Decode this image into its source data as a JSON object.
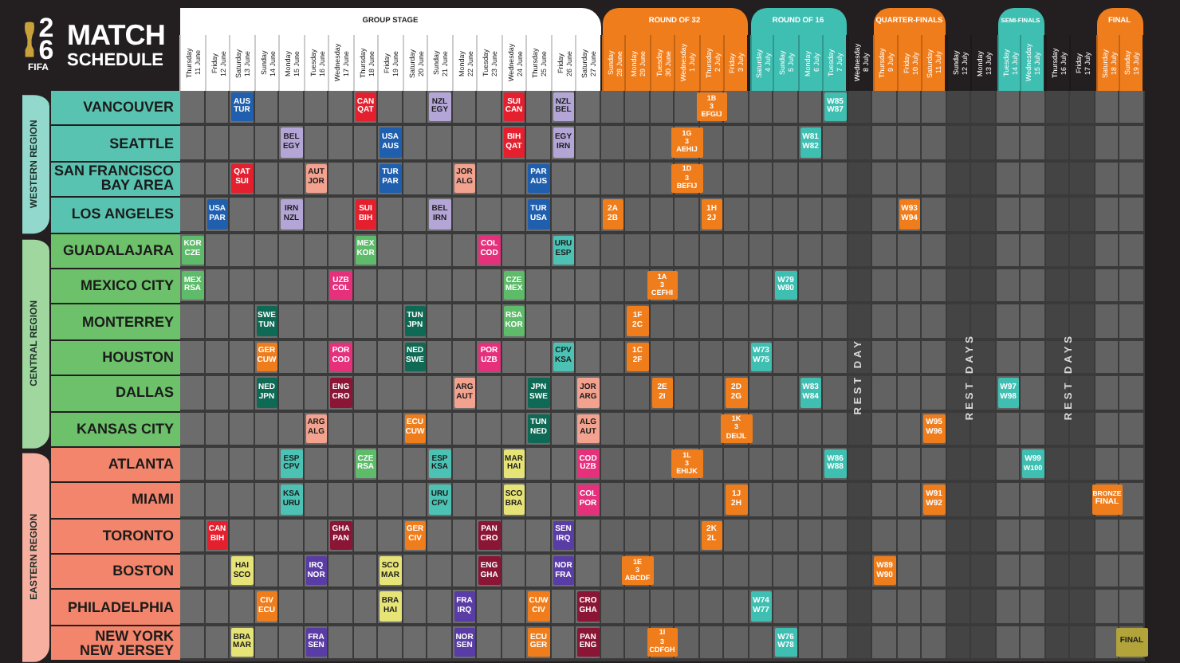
{
  "logo": {
    "number": "26",
    "org": "FIFA",
    "title": "MATCH",
    "subtitle": "SCHEDULE"
  },
  "phases": [
    {
      "kind": "stage",
      "label": "GROUP STAGE",
      "color": "#ffffff",
      "days": [
        {
          "weekday": "Thursday",
          "date": "11 June"
        },
        {
          "weekday": "Friday",
          "date": "12 June"
        },
        {
          "weekday": "Saturday",
          "date": "13 June"
        },
        {
          "weekday": "Sunday",
          "date": "14 June"
        },
        {
          "weekday": "Monday",
          "date": "15 June"
        },
        {
          "weekday": "Tuesday",
          "date": "16 June"
        },
        {
          "weekday": "Wednesday",
          "date": "17 June"
        },
        {
          "weekday": "Thursday",
          "date": "18 June"
        },
        {
          "weekday": "Friday",
          "date": "19 June"
        },
        {
          "weekday": "Saturday",
          "date": "20 June"
        },
        {
          "weekday": "Sunday",
          "date": "21 June"
        },
        {
          "weekday": "Monday",
          "date": "22 June"
        },
        {
          "weekday": "Tuesday",
          "date": "23 June"
        },
        {
          "weekday": "Wednesday",
          "date": "24 June"
        },
        {
          "weekday": "Thursday",
          "date": "25 June"
        },
        {
          "weekday": "Friday",
          "date": "26 June"
        },
        {
          "weekday": "Saturday",
          "date": "27 June"
        }
      ]
    },
    {
      "kind": "stage",
      "label": "ROUND OF 32",
      "color": "#f07d1c",
      "days": [
        {
          "weekday": "Sunday",
          "date": "28 June"
        },
        {
          "weekday": "Monday",
          "date": "29 June"
        },
        {
          "weekday": "Tuesday",
          "date": "30 June"
        },
        {
          "weekday": "Wednesday",
          "date": "1 July"
        },
        {
          "weekday": "Thursday",
          "date": "2 July"
        },
        {
          "weekday": "Friday",
          "date": "3 July"
        }
      ]
    },
    {
      "kind": "stage",
      "label": "ROUND OF 16",
      "color": "#3fbfb2",
      "days": [
        {
          "weekday": "Saturday",
          "date": "4 July"
        },
        {
          "weekday": "Sunday",
          "date": "5 July"
        },
        {
          "weekday": "Monday",
          "date": "6 July"
        },
        {
          "weekday": "Tuesday",
          "date": "7 July"
        }
      ]
    },
    {
      "kind": "rest",
      "note": "REST DAY",
      "days": [
        {
          "weekday": "Wednesday",
          "date": "8 July"
        }
      ]
    },
    {
      "kind": "stage",
      "label": "QUARTER-FINALS",
      "color": "#f07d1c",
      "days": [
        {
          "weekday": "Thursday",
          "date": "9 July"
        },
        {
          "weekday": "Friday",
          "date": "10 July"
        },
        {
          "weekday": "Saturday",
          "date": "11 July"
        }
      ]
    },
    {
      "kind": "rest",
      "note": "REST DAYS",
      "days": [
        {
          "weekday": "Sunday",
          "date": "12 July"
        },
        {
          "weekday": "Monday",
          "date": "13 July"
        }
      ]
    },
    {
      "kind": "stage",
      "label": "SEMI-FINALS",
      "color": "#3fbfb2",
      "days": [
        {
          "weekday": "Tuesday",
          "date": "14 July"
        },
        {
          "weekday": "Wednesday",
          "date": "15 July"
        }
      ]
    },
    {
      "kind": "rest",
      "note": "REST DAYS",
      "days": [
        {
          "weekday": "Thursday",
          "date": "16 July"
        },
        {
          "weekday": "Friday",
          "date": "17 July"
        }
      ]
    },
    {
      "kind": "stage",
      "label": "FINAL",
      "color": "#f07d1c",
      "days": [
        {
          "weekday": "Saturday",
          "date": "18 July"
        },
        {
          "weekday": "Sunday",
          "date": "19 July"
        }
      ]
    }
  ],
  "regions": [
    {
      "label": "WESTERN REGION",
      "color": "#58c3b0",
      "cities": [
        {
          "name": "VANCOUVER",
          "cells": [
            null,
            null,
            {
              "color": "#1f5fae",
              "lines": [
                "AUS",
                "TUR"
              ]
            },
            null,
            null,
            null,
            null,
            {
              "color": "#e4202e",
              "lines": [
                "CAN",
                "QAT"
              ]
            },
            null,
            null,
            {
              "color": "#b3a6d6",
              "lines": [
                "NZL",
                "EGY"
              ]
            },
            null,
            null,
            {
              "color": "#e4202e",
              "lines": [
                "SUI",
                "CAN"
              ]
            },
            null,
            {
              "color": "#b3a6d6",
              "lines": [
                "NZL",
                "BEL"
              ]
            },
            null,
            null,
            null,
            null,
            null,
            {
              "color": "#f07d1c",
              "lines": [
                "1B",
                "3",
                "EFGIJ"
              ]
            },
            null,
            null,
            null,
            null,
            {
              "color": "#3fbfb2",
              "lines": [
                "W85",
                "W87"
              ]
            },
            null,
            null,
            null,
            null,
            null,
            null,
            null,
            null,
            null,
            null,
            null,
            null
          ]
        },
        {
          "name": "SEATTLE",
          "cells": [
            null,
            null,
            null,
            null,
            {
              "color": "#b3a6d6",
              "lines": [
                "BEL",
                "EGY"
              ]
            },
            null,
            null,
            null,
            {
              "color": "#1f5fae",
              "lines": [
                "USA",
                "AUS"
              ]
            },
            null,
            null,
            null,
            null,
            {
              "color": "#e4202e",
              "lines": [
                "BIH",
                "QAT"
              ]
            },
            null,
            {
              "color": "#b3a6d6",
              "lines": [
                "EGY",
                "IRN"
              ]
            },
            null,
            null,
            null,
            null,
            {
              "color": "#f07d1c",
              "lines": [
                "1G",
                "3",
                "AEHIJ"
              ]
            },
            null,
            null,
            null,
            null,
            {
              "color": "#3fbfb2",
              "lines": [
                "W81",
                "W82"
              ]
            },
            null,
            null,
            null,
            null,
            null,
            null,
            null,
            null,
            null,
            null,
            null,
            null,
            null
          ]
        },
        {
          "name": "SAN FRANCISCO\nBAY AREA",
          "cells": [
            null,
            null,
            {
              "color": "#e4202e",
              "lines": [
                "QAT",
                "SUI"
              ]
            },
            null,
            null,
            {
              "color": "#f2a28e",
              "lines": [
                "AUT",
                "JOR"
              ]
            },
            null,
            null,
            {
              "color": "#1f5fae",
              "lines": [
                "TUR",
                "PAR"
              ]
            },
            null,
            null,
            {
              "color": "#f2a28e",
              "lines": [
                "JOR",
                "ALG"
              ]
            },
            null,
            null,
            {
              "color": "#1f5fae",
              "lines": [
                "PAR",
                "AUS"
              ]
            },
            null,
            null,
            null,
            null,
            null,
            {
              "color": "#f07d1c",
              "lines": [
                "1D",
                "3",
                "BEFIJ"
              ]
            },
            null,
            null,
            null,
            null,
            null,
            null,
            null,
            null,
            null,
            null,
            null,
            null,
            null,
            null,
            null,
            null,
            null,
            null
          ]
        },
        {
          "name": "LOS ANGELES",
          "cells": [
            null,
            {
              "color": "#1f5fae",
              "lines": [
                "USA",
                "PAR"
              ]
            },
            null,
            null,
            {
              "color": "#b3a6d6",
              "lines": [
                "IRN",
                "NZL"
              ]
            },
            null,
            null,
            {
              "color": "#e4202e",
              "lines": [
                "SUI",
                "BIH"
              ]
            },
            null,
            null,
            {
              "color": "#b3a6d6",
              "lines": [
                "BEL",
                "IRN"
              ]
            },
            null,
            null,
            null,
            {
              "color": "#1f5fae",
              "lines": [
                "TUR",
                "USA"
              ]
            },
            null,
            null,
            {
              "color": "#f07d1c",
              "lines": [
                "2A",
                "2B"
              ]
            },
            null,
            null,
            null,
            {
              "color": "#f07d1c",
              "lines": [
                "1H",
                "2J"
              ]
            },
            null,
            null,
            null,
            null,
            null,
            null,
            null,
            {
              "color": "#f07d1c",
              "lines": [
                "W93",
                "W94"
              ]
            },
            null,
            null,
            null,
            null,
            null,
            null,
            null,
            null,
            null
          ]
        }
      ]
    },
    {
      "label": "CENTRAL REGION",
      "color": "#6cc16a",
      "cities": [
        {
          "name": "GUADALAJARA",
          "cells": [
            {
              "color": "#5dbb6a",
              "lines": [
                "KOR",
                "CZE"
              ]
            },
            null,
            null,
            null,
            null,
            null,
            null,
            {
              "color": "#5dbb6a",
              "lines": [
                "MEX",
                "KOR"
              ]
            },
            null,
            null,
            null,
            null,
            {
              "color": "#e6307c",
              "lines": [
                "COL",
                "COD"
              ]
            },
            null,
            null,
            {
              "color": "#4cc2b4",
              "lines": [
                "URU",
                "ESP"
              ]
            },
            null,
            null,
            null,
            null,
            null,
            null,
            null,
            null,
            null,
            null,
            null,
            null,
            null,
            null,
            null,
            null,
            null,
            null,
            null,
            null,
            null,
            null,
            null
          ]
        },
        {
          "name": "MEXICO CITY",
          "cells": [
            {
              "color": "#5dbb6a",
              "lines": [
                "MEX",
                "RSA"
              ]
            },
            null,
            null,
            null,
            null,
            null,
            {
              "color": "#e6307c",
              "lines": [
                "UZB",
                "COL"
              ]
            },
            null,
            null,
            null,
            null,
            null,
            null,
            {
              "color": "#5dbb6a",
              "lines": [
                "CZE",
                "MEX"
              ]
            },
            null,
            null,
            null,
            null,
            null,
            {
              "color": "#f07d1c",
              "lines": [
                "1A",
                "3",
                "CEFHI"
              ]
            },
            null,
            null,
            null,
            null,
            {
              "color": "#3fbfb2",
              "lines": [
                "W79",
                "W80"
              ]
            },
            null,
            null,
            null,
            null,
            null,
            null,
            null,
            null,
            null,
            null,
            null,
            null,
            null,
            null
          ]
        },
        {
          "name": "MONTERREY",
          "cells": [
            null,
            null,
            null,
            {
              "color": "#0f6a55",
              "lines": [
                "SWE",
                "TUN"
              ]
            },
            null,
            null,
            null,
            null,
            null,
            {
              "color": "#0f6a55",
              "lines": [
                "TUN",
                "JPN"
              ]
            },
            null,
            null,
            null,
            {
              "color": "#5dbb6a",
              "lines": [
                "RSA",
                "KOR"
              ]
            },
            null,
            null,
            null,
            null,
            {
              "color": "#f07d1c",
              "lines": [
                "1F",
                "2C"
              ]
            },
            null,
            null,
            null,
            null,
            null,
            null,
            null,
            null,
            null,
            null,
            null,
            null,
            null,
            null,
            null,
            null,
            null,
            null,
            null,
            null
          ]
        },
        {
          "name": "HOUSTON",
          "cells": [
            null,
            null,
            null,
            {
              "color": "#f07d1c",
              "lines": [
                "GER",
                "CUW"
              ]
            },
            null,
            null,
            {
              "color": "#e6307c",
              "lines": [
                "POR",
                "COD"
              ]
            },
            null,
            null,
            {
              "color": "#0f6a55",
              "lines": [
                "NED",
                "SWE"
              ]
            },
            null,
            null,
            {
              "color": "#e6307c",
              "lines": [
                "POR",
                "UZB"
              ]
            },
            null,
            null,
            {
              "color": "#4cc2b4",
              "lines": [
                "CPV",
                "KSA"
              ]
            },
            null,
            null,
            {
              "color": "#f07d1c",
              "lines": [
                "1C",
                "2F"
              ]
            },
            null,
            null,
            null,
            null,
            {
              "color": "#3fbfb2",
              "lines": [
                "W73",
                "W75"
              ]
            },
            null,
            null,
            null,
            null,
            null,
            null,
            null,
            null,
            null,
            null,
            null,
            null,
            null,
            null,
            null
          ]
        },
        {
          "name": "DALLAS",
          "cells": [
            null,
            null,
            null,
            {
              "color": "#0f6a55",
              "lines": [
                "NED",
                "JPN"
              ]
            },
            null,
            null,
            {
              "color": "#8a1535",
              "lines": [
                "ENG",
                "CRO"
              ]
            },
            null,
            null,
            null,
            null,
            {
              "color": "#f2a28e",
              "lines": [
                "ARG",
                "AUT"
              ]
            },
            null,
            null,
            {
              "color": "#0f6a55",
              "lines": [
                "JPN",
                "SWE"
              ]
            },
            null,
            {
              "color": "#f2a28e",
              "lines": [
                "JOR",
                "ARG"
              ]
            },
            null,
            null,
            {
              "color": "#f07d1c",
              "lines": [
                "2E",
                "2I"
              ]
            },
            null,
            null,
            {
              "color": "#f07d1c",
              "lines": [
                "2D",
                "2G"
              ]
            },
            null,
            null,
            {
              "color": "#3fbfb2",
              "lines": [
                "W83",
                "W84"
              ]
            },
            null,
            null,
            null,
            null,
            null,
            null,
            null,
            {
              "color": "#3fbfb2",
              "lines": [
                "W97",
                "W98"
              ]
            },
            null,
            null,
            null,
            null,
            null
          ]
        },
        {
          "name": "KANSAS CITY",
          "cells": [
            null,
            null,
            null,
            null,
            null,
            {
              "color": "#f2a28e",
              "lines": [
                "ARG",
                "ALG"
              ]
            },
            null,
            null,
            null,
            {
              "color": "#f07d1c",
              "lines": [
                "ECU",
                "CUW"
              ]
            },
            null,
            null,
            null,
            null,
            {
              "color": "#0f6a55",
              "lines": [
                "TUN",
                "NED"
              ]
            },
            null,
            {
              "color": "#f2a28e",
              "lines": [
                "ALG",
                "AUT"
              ]
            },
            null,
            null,
            null,
            null,
            null,
            {
              "color": "#f07d1c",
              "lines": [
                "1K",
                "3",
                "DEIJL"
              ]
            },
            null,
            null,
            null,
            null,
            null,
            null,
            null,
            {
              "color": "#f07d1c",
              "lines": [
                "W95",
                "W96"
              ]
            },
            null,
            null,
            null,
            null,
            null,
            null,
            null,
            null
          ]
        }
      ]
    },
    {
      "label": "EASTERN REGION",
      "color": "#f2856b",
      "cities": [
        {
          "name": "ATLANTA",
          "cells": [
            null,
            null,
            null,
            null,
            {
              "color": "#4cc2b4",
              "lines": [
                "ESP",
                "CPV"
              ]
            },
            null,
            null,
            {
              "color": "#5dbb6a",
              "lines": [
                "CZE",
                "RSA"
              ]
            },
            null,
            null,
            {
              "color": "#4cc2b4",
              "lines": [
                "ESP",
                "KSA"
              ]
            },
            null,
            null,
            {
              "color": "#e6e377",
              "lines": [
                "MAR",
                "HAI"
              ]
            },
            null,
            null,
            {
              "color": "#e6307c",
              "lines": [
                "COD",
                "UZB"
              ]
            },
            null,
            null,
            null,
            {
              "color": "#f07d1c",
              "lines": [
                "1L",
                "3",
                "EHIJK"
              ]
            },
            null,
            null,
            null,
            null,
            null,
            {
              "color": "#3fbfb2",
              "lines": [
                "W86",
                "W88"
              ]
            },
            null,
            null,
            null,
            null,
            null,
            null,
            null,
            {
              "color": "#3fbfb2",
              "lines": [
                "W99",
                "W100"
              ]
            },
            null,
            null,
            null,
            null
          ]
        },
        {
          "name": "MIAMI",
          "cells": [
            null,
            null,
            null,
            null,
            {
              "color": "#4cc2b4",
              "lines": [
                "KSA",
                "URU"
              ]
            },
            null,
            null,
            null,
            null,
            null,
            {
              "color": "#4cc2b4",
              "lines": [
                "URU",
                "CPV"
              ]
            },
            null,
            null,
            {
              "color": "#e6e377",
              "lines": [
                "SCO",
                "BRA"
              ]
            },
            null,
            null,
            {
              "color": "#e6307c",
              "lines": [
                "COL",
                "POR"
              ]
            },
            null,
            null,
            null,
            null,
            null,
            {
              "color": "#f07d1c",
              "lines": [
                "1J",
                "2H"
              ]
            },
            null,
            null,
            null,
            null,
            null,
            null,
            null,
            {
              "color": "#f07d1c",
              "lines": [
                "W91",
                "W92"
              ]
            },
            null,
            null,
            null,
            null,
            null,
            null,
            {
              "color": "#f07d1c",
              "lines": [
                "BRONZE",
                "FINAL"
              ]
            },
            null
          ]
        },
        {
          "name": "TORONTO",
          "cells": [
            null,
            {
              "color": "#e4202e",
              "lines": [
                "CAN",
                "BIH"
              ]
            },
            null,
            null,
            null,
            null,
            {
              "color": "#8a1535",
              "lines": [
                "GHA",
                "PAN"
              ]
            },
            null,
            null,
            {
              "color": "#f07d1c",
              "lines": [
                "GER",
                "CIV"
              ]
            },
            null,
            null,
            {
              "color": "#8a1535",
              "lines": [
                "PAN",
                "CRO"
              ]
            },
            null,
            null,
            {
              "color": "#5a3ca6",
              "lines": [
                "SEN",
                "IRQ"
              ]
            },
            null,
            null,
            null,
            null,
            null,
            {
              "color": "#f07d1c",
              "lines": [
                "2K",
                "2L"
              ]
            },
            null,
            null,
            null,
            null,
            null,
            null,
            null,
            null,
            null,
            null,
            null,
            null,
            null,
            null,
            null,
            null,
            null
          ]
        },
        {
          "name": "BOSTON",
          "cells": [
            null,
            null,
            {
              "color": "#e6e377",
              "lines": [
                "HAI",
                "SCO"
              ]
            },
            null,
            null,
            {
              "color": "#5a3ca6",
              "lines": [
                "IRQ",
                "NOR"
              ]
            },
            null,
            null,
            {
              "color": "#e6e377",
              "lines": [
                "SCO",
                "MAR"
              ]
            },
            null,
            null,
            null,
            {
              "color": "#8a1535",
              "lines": [
                "ENG",
                "GHA"
              ]
            },
            null,
            null,
            {
              "color": "#5a3ca6",
              "lines": [
                "NOR",
                "FRA"
              ]
            },
            null,
            null,
            {
              "color": "#f07d1c",
              "lines": [
                "1E",
                "3",
                "ABCDF"
              ]
            },
            null,
            null,
            null,
            null,
            null,
            null,
            null,
            null,
            null,
            {
              "color": "#f07d1c",
              "lines": [
                "W89",
                "W90"
              ]
            },
            null,
            null,
            null,
            null,
            null,
            null,
            null,
            null,
            null,
            null
          ]
        },
        {
          "name": "PHILADELPHIA",
          "cells": [
            null,
            null,
            null,
            {
              "color": "#f07d1c",
              "lines": [
                "CIV",
                "ECU"
              ]
            },
            null,
            null,
            null,
            null,
            {
              "color": "#e6e377",
              "lines": [
                "BRA",
                "HAI"
              ]
            },
            null,
            null,
            {
              "color": "#5a3ca6",
              "lines": [
                "FRA",
                "IRQ"
              ]
            },
            null,
            null,
            {
              "color": "#f07d1c",
              "lines": [
                "CUW",
                "CIV"
              ]
            },
            null,
            {
              "color": "#8a1535",
              "lines": [
                "CRO",
                "GHA"
              ]
            },
            null,
            null,
            null,
            null,
            null,
            null,
            {
              "color": "#3fbfb2",
              "lines": [
                "W74",
                "W77"
              ]
            },
            null,
            null,
            null,
            null,
            null,
            null,
            null,
            null,
            null,
            null,
            null,
            null,
            null,
            null,
            null
          ]
        },
        {
          "name": "NEW YORK\nNEW JERSEY",
          "cells": [
            null,
            null,
            {
              "color": "#e6e377",
              "lines": [
                "BRA",
                "MAR"
              ]
            },
            null,
            null,
            {
              "color": "#5a3ca6",
              "lines": [
                "FRA",
                "SEN"
              ]
            },
            null,
            null,
            null,
            null,
            null,
            {
              "color": "#5a3ca6",
              "lines": [
                "NOR",
                "SEN"
              ]
            },
            null,
            null,
            {
              "color": "#f07d1c",
              "lines": [
                "ECU",
                "GER"
              ]
            },
            null,
            {
              "color": "#8a1535",
              "lines": [
                "PAN",
                "ENG"
              ]
            },
            null,
            null,
            {
              "color": "#f07d1c",
              "lines": [
                "1I",
                "3",
                "CDFGH"
              ]
            },
            null,
            null,
            null,
            null,
            {
              "color": "#3fbfb2",
              "lines": [
                "W76",
                "W78"
              ]
            },
            null,
            null,
            null,
            null,
            null,
            null,
            null,
            null,
            null,
            null,
            null,
            null,
            null,
            {
              "color": "#b2a33a",
              "lines": [
                "FINAL"
              ]
            }
          ]
        }
      ]
    }
  ]
}
